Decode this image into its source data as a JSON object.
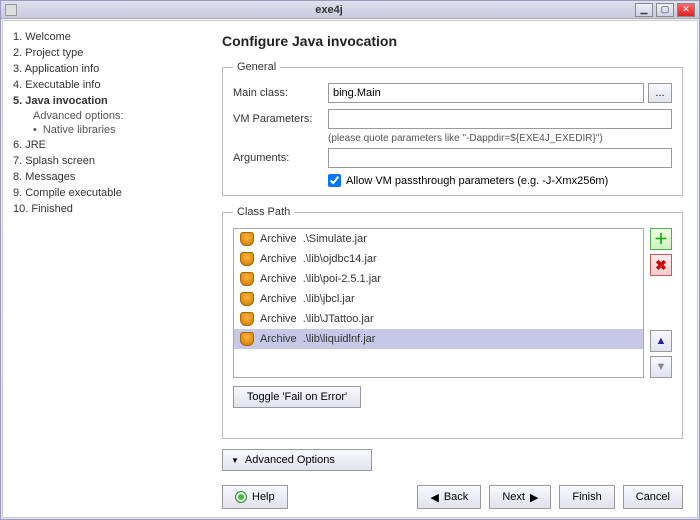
{
  "window": {
    "title": "exe4j"
  },
  "brand": "exe4j",
  "steps": [
    {
      "label": "1. Welcome"
    },
    {
      "label": "2. Project type"
    },
    {
      "label": "3. Application info"
    },
    {
      "label": "4. Executable info"
    },
    {
      "label": "5. Java invocation",
      "current": true,
      "sublabel": "Advanced options:",
      "subitems": [
        "Native libraries"
      ]
    },
    {
      "label": "6. JRE"
    },
    {
      "label": "7. Splash screen"
    },
    {
      "label": "8. Messages"
    },
    {
      "label": "9. Compile executable"
    },
    {
      "label": "10. Finished"
    }
  ],
  "page_title": "Configure Java invocation",
  "general": {
    "legend": "General",
    "main_class_label": "Main class:",
    "main_class_value": "bing.Main",
    "browse_label": "...",
    "vm_params_label": "VM Parameters:",
    "vm_params_value": "",
    "vm_hint": "(please quote parameters like \"-Dappdir=${EXE4J_EXEDIR}\")",
    "arguments_label": "Arguments:",
    "arguments_value": "",
    "allow_passthrough_label": "Allow VM passthrough parameters (e.g. -J-Xmx256m)",
    "allow_passthrough_checked": true
  },
  "classpath": {
    "legend": "Class Path",
    "items": [
      {
        "type": "Archive",
        "path": ".\\Simulate.jar",
        "selected": false
      },
      {
        "type": "Archive",
        "path": ".\\lib\\ojdbc14.jar",
        "selected": false
      },
      {
        "type": "Archive",
        "path": ".\\lib\\poi-2.5.1.jar",
        "selected": false
      },
      {
        "type": "Archive",
        "path": ".\\lib\\jbcl.jar",
        "selected": false
      },
      {
        "type": "Archive",
        "path": ".\\lib\\JTattoo.jar",
        "selected": false
      },
      {
        "type": "Archive",
        "path": ".\\lib\\liquidlnf.jar",
        "selected": true
      }
    ],
    "toggle_fail_label": "Toggle 'Fail on Error'"
  },
  "advanced_options_label": "Advanced Options",
  "footer": {
    "help": "Help",
    "back": "Back",
    "next": "Next",
    "finish": "Finish",
    "cancel": "Cancel"
  }
}
